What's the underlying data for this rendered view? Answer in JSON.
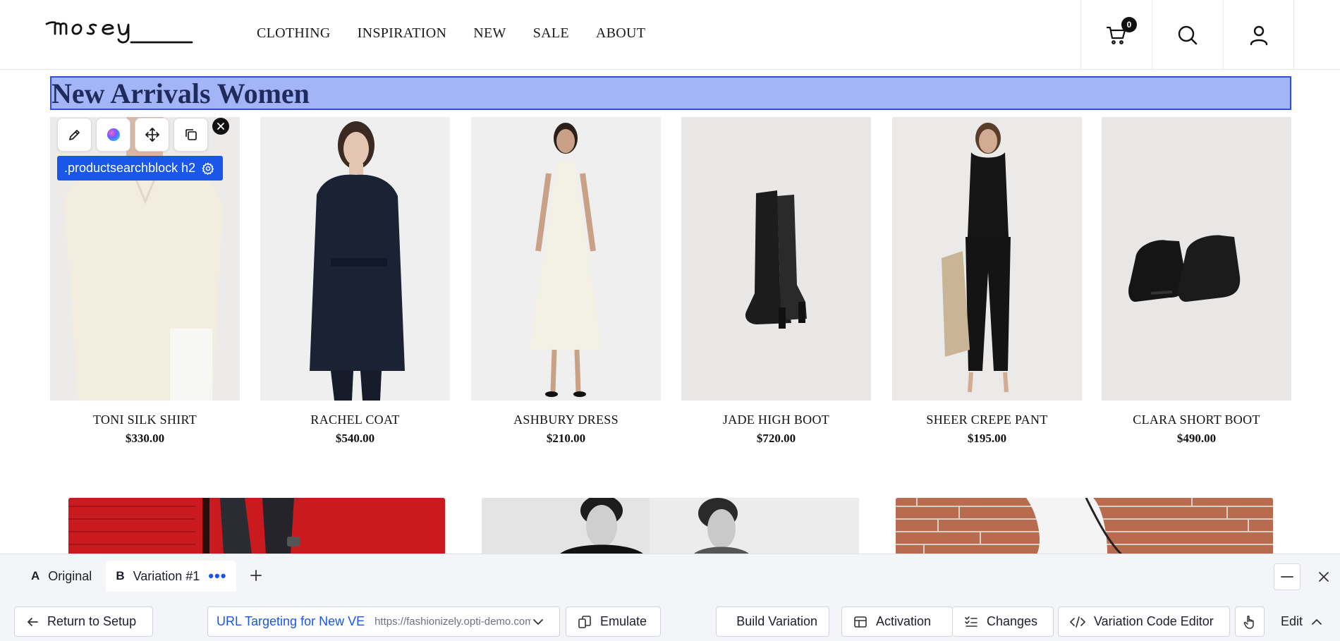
{
  "header": {
    "logo_text": "mosey",
    "nav": [
      "CLOTHING",
      "INSPIRATION",
      "NEW",
      "SALE",
      "ABOUT"
    ],
    "cart_count": "0",
    "icons": [
      "cart-icon",
      "search-icon",
      "account-icon"
    ]
  },
  "section": {
    "title": "New Arrivals Women"
  },
  "editor_overlay": {
    "selector_label": ".productsearchblock h2",
    "tools": [
      "edit-icon",
      "ai-orb-icon",
      "move-icon",
      "duplicate-icon"
    ],
    "close": "close-icon"
  },
  "products": [
    {
      "name": "TONI SILK SHIRT",
      "price": "$330.00"
    },
    {
      "name": "RACHEL COAT",
      "price": "$540.00"
    },
    {
      "name": "ASHBURY DRESS",
      "price": "$210.00"
    },
    {
      "name": "JADE HIGH BOOT",
      "price": "$720.00"
    },
    {
      "name": "SHEER CREPE PANT",
      "price": "$195.00"
    },
    {
      "name": "CLARA SHORT BOOT",
      "price": "$490.00"
    }
  ],
  "panel": {
    "tabs": [
      {
        "letter": "A",
        "label": "Original"
      },
      {
        "letter": "B",
        "label": "Variation #1",
        "more": "•••"
      }
    ],
    "return_label": "Return to Setup",
    "url_target_name": "URL Targeting for New VE",
    "url_target_value": "https://fashionizely.opti-demo.com",
    "emulate_label": "Emulate",
    "build_label": "Build Variation",
    "activation_label": "Activation",
    "changes_label": "Changes",
    "code_editor_label": "Variation Code Editor",
    "mode_label": "Edit"
  },
  "colors": {
    "selection_fill": "#a3b4f7",
    "selection_border": "#2f4fd6",
    "accent_blue": "#1a56e8"
  }
}
